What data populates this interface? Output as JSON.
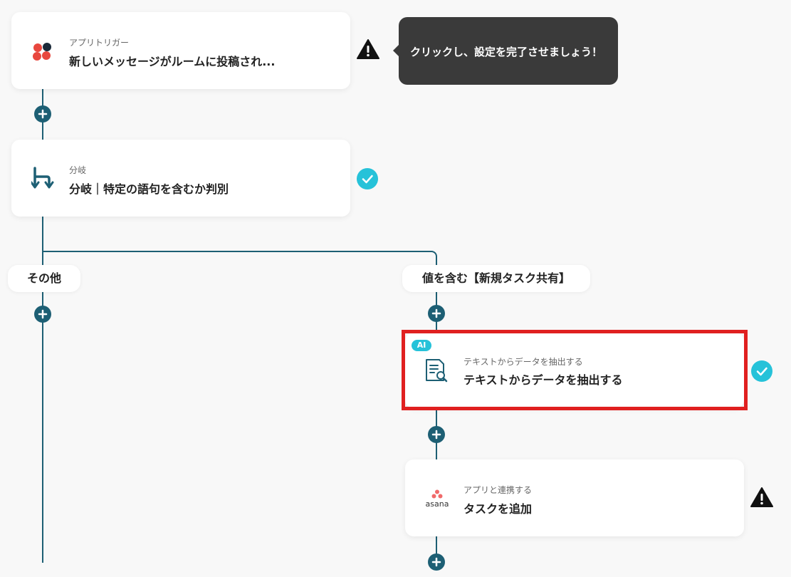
{
  "steps": [
    {
      "id": "trigger",
      "subtitle": "アプリトリガー",
      "title": "新しいメッセージがルームに投稿され...",
      "icon": "chatwork-logo-icon",
      "status": "warning"
    },
    {
      "id": "branch",
      "subtitle": "分岐",
      "title": "分岐｜特定の語句を含むか判別",
      "icon": "branch-icon",
      "status": "done"
    },
    {
      "id": "extract",
      "badge": "AI",
      "subtitle": "テキストからデータを抽出する",
      "title": "テキストからデータを抽出する",
      "icon": "document-search-icon",
      "status": "done",
      "highlighted": true
    },
    {
      "id": "asana",
      "subtitle": "アプリと連携する",
      "title": "タスクを追加",
      "icon": "asana-logo-icon",
      "icon_text": "asana",
      "status": "warning"
    }
  ],
  "branches": {
    "left_label": "その他",
    "right_label": "値を含む【新規タスク共有】"
  },
  "tooltip": {
    "text": "クリックし、設定を完了させましょう！"
  },
  "colors": {
    "accent": "#1d5f74",
    "check": "#26c2d9",
    "highlight": "#e02020",
    "tooltip_bg": "#3a3a3a"
  }
}
